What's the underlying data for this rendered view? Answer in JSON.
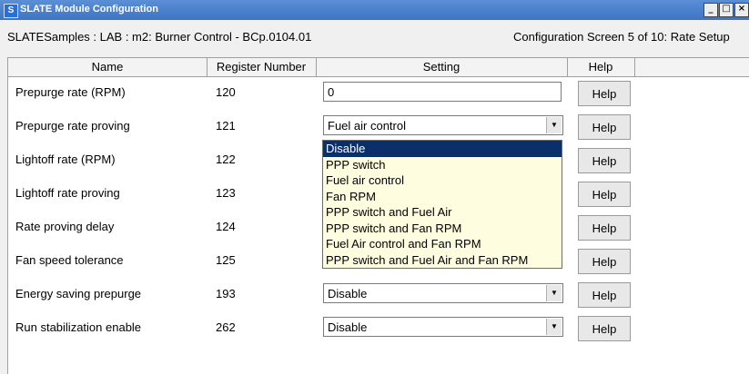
{
  "window": {
    "app_icon": "S",
    "title": "SLATE Module Configuration",
    "buttons": [
      "_",
      "□",
      "×"
    ]
  },
  "info": {
    "path": "SLATESamples : LAB : m2: Burner Control - BCp.0104.01",
    "screen": "Configuration Screen 5 of 10: Rate Setup"
  },
  "columns": [
    "Name",
    "Register Number",
    "Setting",
    "Help"
  ],
  "rows": [
    {
      "name": "Prepurge rate (RPM)",
      "register": "120",
      "setting": "0",
      "help": "Help"
    },
    {
      "name": "Prepurge rate proving",
      "register": "121",
      "setting": "Fuel air control",
      "help": "Help"
    },
    {
      "name": "Lightoff rate (RPM)",
      "register": "122",
      "setting": "",
      "help": "Help"
    },
    {
      "name": "Lightoff rate proving",
      "register": "123",
      "setting": "",
      "help": "Help"
    },
    {
      "name": "Rate proving delay",
      "register": "124",
      "setting": "",
      "help": "Help"
    },
    {
      "name": "Fan speed tolerance",
      "register": "125",
      "setting": "",
      "help": "Help"
    },
    {
      "name": "Energy saving prepurge",
      "register": "193",
      "setting": "Disable",
      "help": "Help"
    },
    {
      "name": "Run stabilization enable",
      "register": "262",
      "setting": "Disable",
      "help": "Help"
    }
  ],
  "dropdown": {
    "options": [
      "Disable",
      "PPP switch",
      "Fuel air control",
      "Fan RPM",
      "PPP switch and Fuel Air",
      "PPP switch and Fan RPM",
      "Fuel Air control and Fan RPM",
      "PPP switch and Fuel Air and Fan RPM"
    ],
    "highlighted": "Disable"
  },
  "colors": {
    "titlebar": "#3d74c3",
    "dropdown_bg": "#fffde0",
    "highlight": "#0b2f6b"
  }
}
